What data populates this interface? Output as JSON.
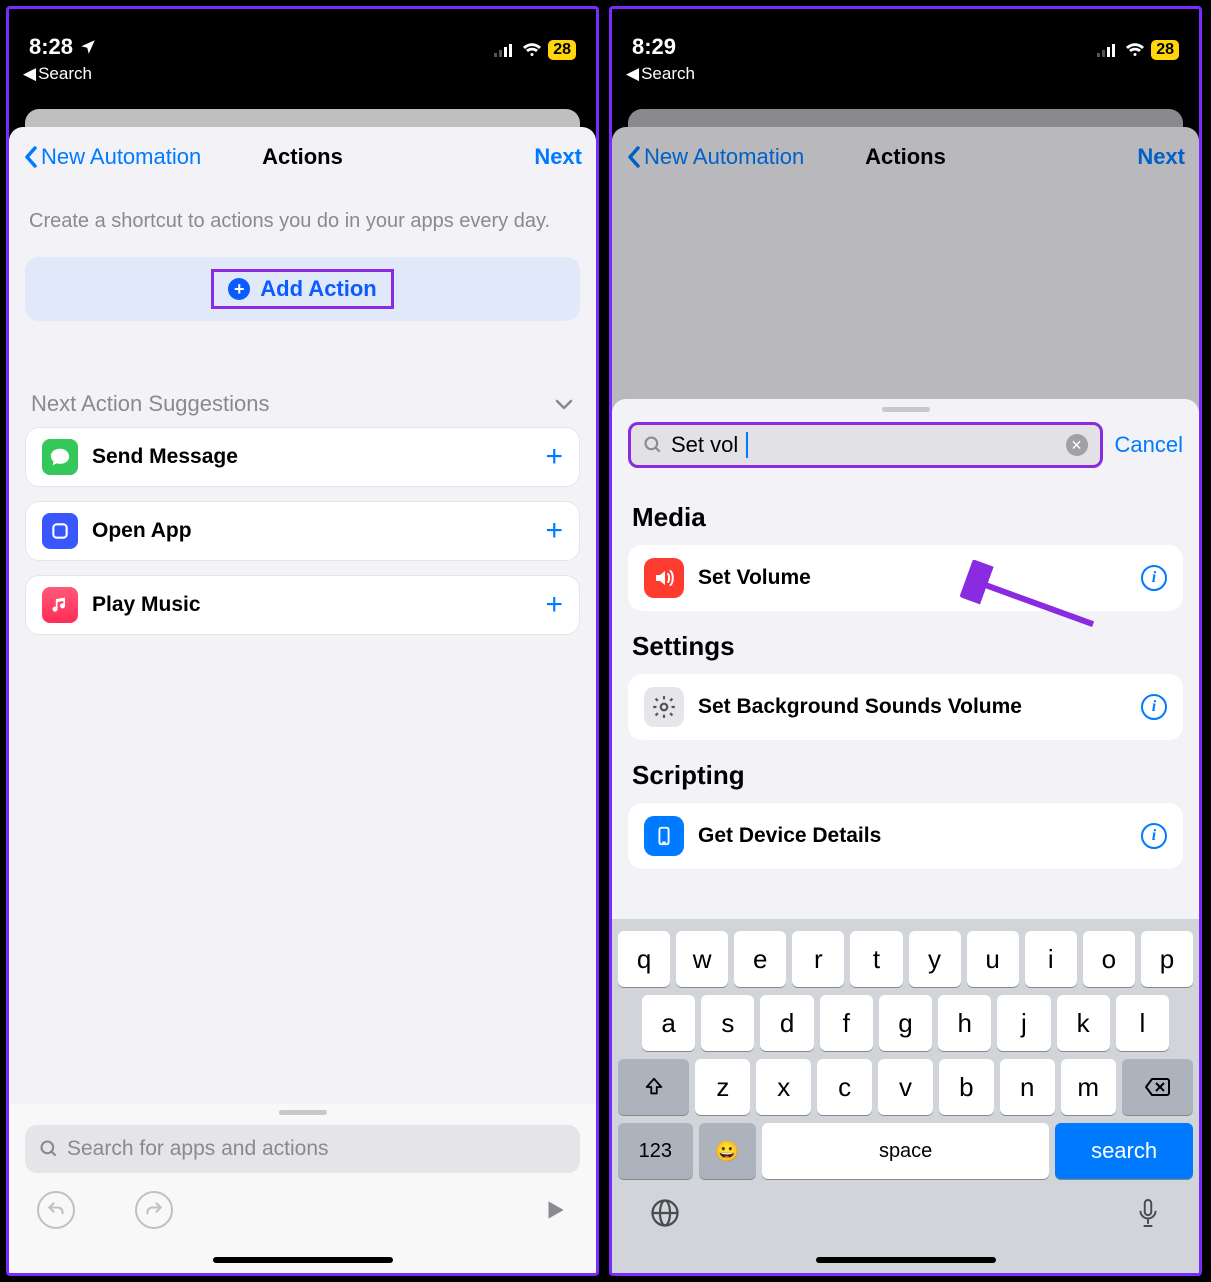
{
  "left": {
    "status": {
      "time": "8:28",
      "battery": "28",
      "back_app": "Search"
    },
    "nav": {
      "back": "New Automation",
      "title": "Actions",
      "next": "Next"
    },
    "intro": "Create a shortcut to actions you do in your apps every day.",
    "add_action": "Add Action",
    "suggestions_header": "Next Action Suggestions",
    "suggestions": [
      {
        "label": "Send Message",
        "icon": "messages",
        "color": "#34c759"
      },
      {
        "label": "Open App",
        "icon": "open-app",
        "color": "#3a56ff"
      },
      {
        "label": "Play Music",
        "icon": "music",
        "color": "#ff2d55"
      }
    ],
    "search_placeholder": "Search for apps and actions"
  },
  "right": {
    "status": {
      "time": "8:29",
      "battery": "28",
      "back_app": "Search"
    },
    "nav": {
      "back": "New Automation",
      "title": "Actions",
      "next": "Next"
    },
    "search_value": "Set vol",
    "cancel": "Cancel",
    "sections": [
      {
        "title": "Media",
        "items": [
          {
            "label": "Set Volume",
            "icon": "volume",
            "color": "#ff3b30"
          }
        ]
      },
      {
        "title": "Settings",
        "items": [
          {
            "label": "Set Background Sounds Volume",
            "icon": "settings",
            "color": "#8e8e93"
          }
        ]
      },
      {
        "title": "Scripting",
        "items": [
          {
            "label": "Get Device Details",
            "icon": "device",
            "color": "#007aff"
          }
        ]
      }
    ],
    "keyboard": {
      "row1": [
        "q",
        "w",
        "e",
        "r",
        "t",
        "y",
        "u",
        "i",
        "o",
        "p"
      ],
      "row2": [
        "a",
        "s",
        "d",
        "f",
        "g",
        "h",
        "j",
        "k",
        "l"
      ],
      "row3": [
        "z",
        "x",
        "c",
        "v",
        "b",
        "n",
        "m"
      ],
      "numeric": "123",
      "space": "space",
      "search": "search"
    }
  }
}
